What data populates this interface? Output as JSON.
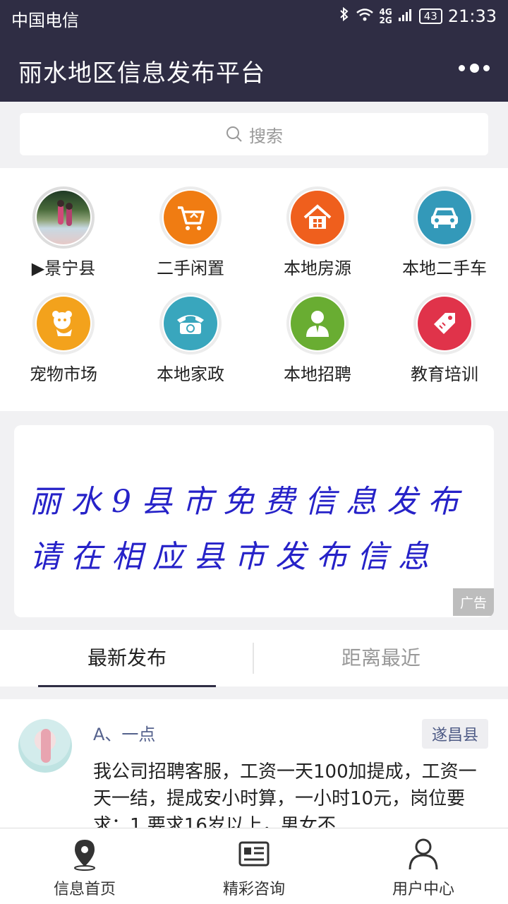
{
  "status_bar": {
    "carrier": "中国电信",
    "network": "4G\n2G",
    "battery": "43",
    "time": "21:33"
  },
  "header": {
    "title": "丽水地区信息发布平台",
    "menu_icon": "more-dots-icon"
  },
  "search": {
    "placeholder": "搜索",
    "icon": "search-icon"
  },
  "categories": [
    {
      "label": "▶景宁县",
      "icon": "county-photo",
      "color": "#6a8a55"
    },
    {
      "label": "二手闲置",
      "icon": "cart-icon",
      "color": "#f07c12"
    },
    {
      "label": "本地房源",
      "icon": "house-icon",
      "color": "#ef5f1d"
    },
    {
      "label": "本地二手车",
      "icon": "car-icon",
      "color": "#3399b9"
    },
    {
      "label": "宠物市场",
      "icon": "pet-icon",
      "color": "#f3a21c"
    },
    {
      "label": "本地家政",
      "icon": "phone-icon",
      "color": "#39a6bd"
    },
    {
      "label": "本地招聘",
      "icon": "person-icon",
      "color": "#69ad32"
    },
    {
      "label": "教育培训",
      "icon": "tag-icon",
      "color": "#e0334a"
    }
  ],
  "banner": {
    "line1": "丽水9县市免费信息发布",
    "line2": "请在相应县市发布信息",
    "ad_label": "广告",
    "text_color": "#2622c8"
  },
  "tabs": [
    {
      "label": "最新发布",
      "active": true
    },
    {
      "label": "距离最近",
      "active": false
    }
  ],
  "post": {
    "user": "A、一点",
    "county": "遂昌县",
    "content": "我公司招聘客服，工资一天100加提成，工资一天一结，提成安小时算，一小时10元，岗位要求：1.要求16岁以上，男女不"
  },
  "bottom_nav": [
    {
      "label": "信息首页",
      "icon": "location-pin-icon"
    },
    {
      "label": "精彩咨询",
      "icon": "news-icon"
    },
    {
      "label": "用户中心",
      "icon": "user-icon"
    }
  ],
  "colors": {
    "header_bg": "#2f2d44"
  }
}
